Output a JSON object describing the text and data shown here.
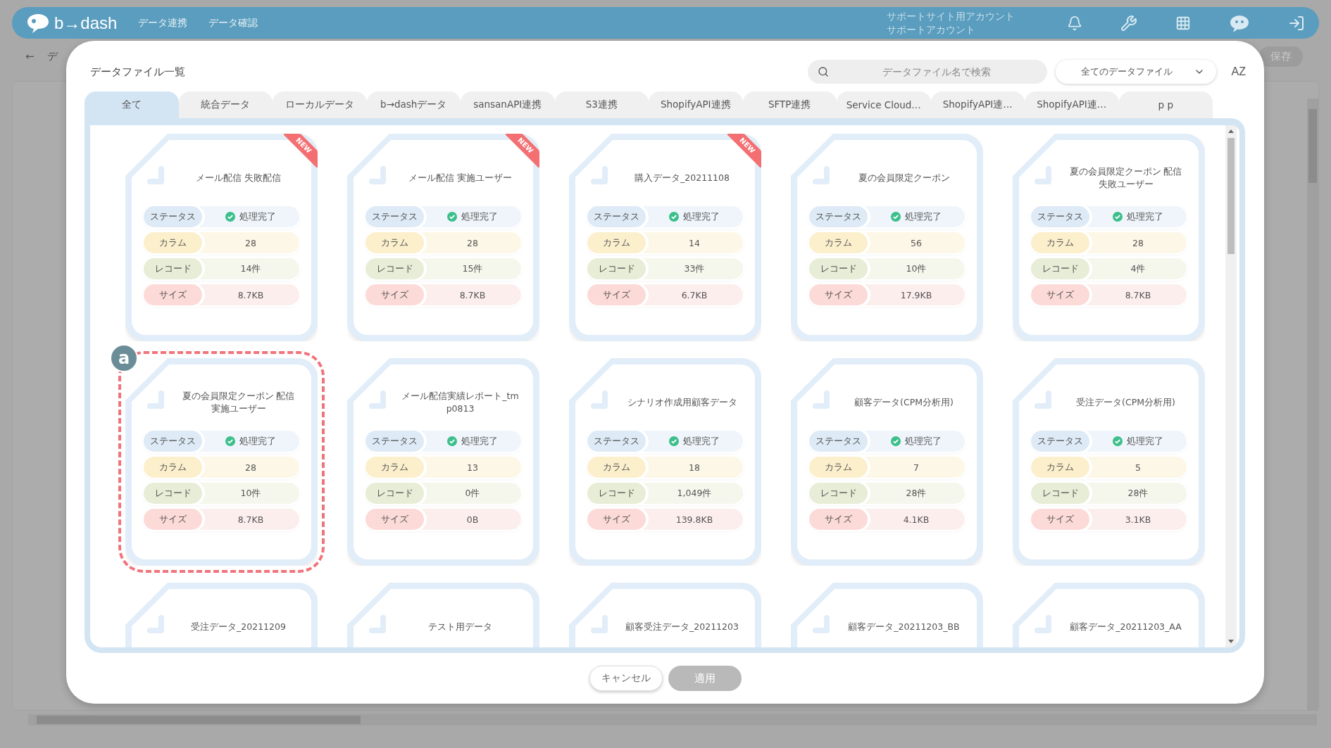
{
  "header": {
    "logo": "b→dash",
    "nav": [
      "データ連携",
      "データ確認"
    ],
    "account": [
      "サポートサイト用アカウント",
      "サポートアカウント"
    ]
  },
  "toolbar": {
    "back": "←",
    "crumb": "デ",
    "save": "保存"
  },
  "dialog": {
    "title": "データファイル一覧",
    "search": {
      "placeholder": "データファイル名で検索"
    },
    "filter": {
      "value": "全てのデータファイル"
    },
    "sort": "AZ",
    "tabs": [
      {
        "label": "全て",
        "selected": true
      },
      {
        "label": "統合データ",
        "selected": false
      },
      {
        "label": "ローカルデータ",
        "selected": false
      },
      {
        "label": "b→dashデータ",
        "selected": false
      },
      {
        "label": "sansanAPI連携",
        "selected": false
      },
      {
        "label": "S3連携",
        "selected": false
      },
      {
        "label": "ShopifyAPI連携",
        "selected": false
      },
      {
        "label": "SFTP連携",
        "selected": false
      },
      {
        "label": "Service Cloud…",
        "selected": false
      },
      {
        "label": "ShopifyAPI連…",
        "selected": false
      },
      {
        "label": "ShopifyAPI連…",
        "selected": false
      },
      {
        "label": "p p",
        "selected": false
      }
    ],
    "cards": [
      {
        "title": "メール配信 失敗配信",
        "ribbon": "NEW",
        "highlighted": false,
        "fields": [
          {
            "kind": "status",
            "label": "ステータス",
            "value": "処理完了"
          },
          {
            "kind": "columns",
            "label": "カラム",
            "value": "28"
          },
          {
            "kind": "records",
            "label": "レコード",
            "value": "14件"
          },
          {
            "kind": "size",
            "label": "サイズ",
            "value": "8.7KB"
          }
        ]
      },
      {
        "title": "メール配信 実施ユーザー",
        "ribbon": "NEW",
        "highlighted": false,
        "fields": [
          {
            "kind": "status",
            "label": "ステータス",
            "value": "処理完了"
          },
          {
            "kind": "columns",
            "label": "カラム",
            "value": "28"
          },
          {
            "kind": "records",
            "label": "レコード",
            "value": "15件"
          },
          {
            "kind": "size",
            "label": "サイズ",
            "value": "8.7KB"
          }
        ]
      },
      {
        "title": "購入データ_20211108",
        "ribbon": "NEW",
        "highlighted": false,
        "fields": [
          {
            "kind": "status",
            "label": "ステータス",
            "value": "処理完了"
          },
          {
            "kind": "columns",
            "label": "カラム",
            "value": "14"
          },
          {
            "kind": "records",
            "label": "レコード",
            "value": "33件"
          },
          {
            "kind": "size",
            "label": "サイズ",
            "value": "6.7KB"
          }
        ]
      },
      {
        "title": "夏の会員限定クーポン",
        "highlighted": false,
        "fields": [
          {
            "kind": "status",
            "label": "ステータス",
            "value": "処理完了"
          },
          {
            "kind": "columns",
            "label": "カラム",
            "value": "56"
          },
          {
            "kind": "records",
            "label": "レコード",
            "value": "10件"
          },
          {
            "kind": "size",
            "label": "サイズ",
            "value": "17.9KB"
          }
        ]
      },
      {
        "title": "夏の会員限定クーポン 配信失敗ユーザー",
        "highlighted": false,
        "fields": [
          {
            "kind": "status",
            "label": "ステータス",
            "value": "処理完了"
          },
          {
            "kind": "columns",
            "label": "カラム",
            "value": "28"
          },
          {
            "kind": "records",
            "label": "レコード",
            "value": "4件"
          },
          {
            "kind": "size",
            "label": "サイズ",
            "value": "8.7KB"
          }
        ]
      },
      {
        "title": "夏の会員限定クーポン 配信実施ユーザー",
        "highlighted": true,
        "annotation": "a",
        "fields": [
          {
            "kind": "status",
            "label": "ステータス",
            "value": "処理完了"
          },
          {
            "kind": "columns",
            "label": "カラム",
            "value": "28"
          },
          {
            "kind": "records",
            "label": "レコード",
            "value": "10件"
          },
          {
            "kind": "size",
            "label": "サイズ",
            "value": "8.7KB"
          }
        ]
      },
      {
        "title": "メール配信実績レポート_tmp0813",
        "highlighted": false,
        "fields": [
          {
            "kind": "status",
            "label": "ステータス",
            "value": "処理完了"
          },
          {
            "kind": "columns",
            "label": "カラム",
            "value": "13"
          },
          {
            "kind": "records",
            "label": "レコード",
            "value": "0件"
          },
          {
            "kind": "size",
            "label": "サイズ",
            "value": "0B"
          }
        ]
      },
      {
        "title": "シナリオ作成用顧客データ",
        "highlighted": false,
        "fields": [
          {
            "kind": "status",
            "label": "ステータス",
            "value": "処理完了"
          },
          {
            "kind": "columns",
            "label": "カラム",
            "value": "18"
          },
          {
            "kind": "records",
            "label": "レコード",
            "value": "1,049件"
          },
          {
            "kind": "size",
            "label": "サイズ",
            "value": "139.8KB"
          }
        ]
      },
      {
        "title": "顧客データ(CPM分析用)",
        "highlighted": false,
        "fields": [
          {
            "kind": "status",
            "label": "ステータス",
            "value": "処理完了"
          },
          {
            "kind": "columns",
            "label": "カラム",
            "value": "7"
          },
          {
            "kind": "records",
            "label": "レコード",
            "value": "28件"
          },
          {
            "kind": "size",
            "label": "サイズ",
            "value": "4.1KB"
          }
        ]
      },
      {
        "title": "受注データ(CPM分析用)",
        "highlighted": false,
        "fields": [
          {
            "kind": "status",
            "label": "ステータス",
            "value": "処理完了"
          },
          {
            "kind": "columns",
            "label": "カラム",
            "value": "5"
          },
          {
            "kind": "records",
            "label": "レコード",
            "value": "28件"
          },
          {
            "kind": "size",
            "label": "サイズ",
            "value": "3.1KB"
          }
        ]
      },
      {
        "title": "受注データ_20211209",
        "highlighted": false
      },
      {
        "title": "テスト用データ",
        "highlighted": false
      },
      {
        "title": "顧客受注データ_20211203",
        "highlighted": false
      },
      {
        "title": "顧客データ_20211203_BB",
        "highlighted": false
      },
      {
        "title": "顧客データ_20211203_AA",
        "highlighted": false
      }
    ],
    "buttons": {
      "cancel": {
        "label": "キャンセル"
      },
      "apply": {
        "label": "適用",
        "disabled": true
      }
    }
  }
}
